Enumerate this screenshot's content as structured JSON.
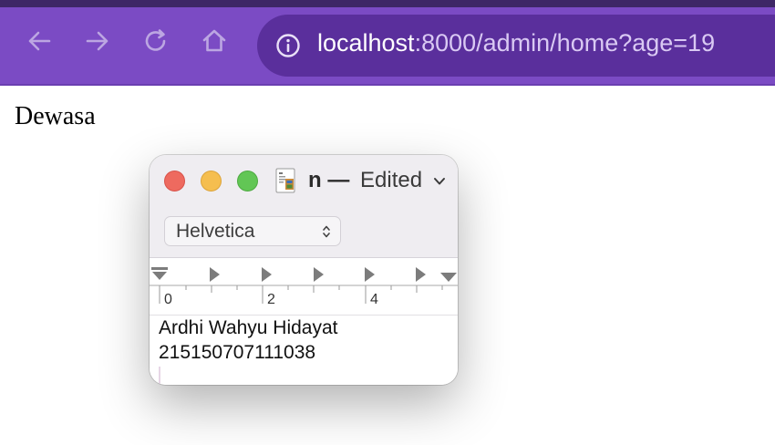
{
  "browser": {
    "url_host": "localhost",
    "url_rest": ":8000/admin/home?age=19",
    "colors": {
      "toolbar": "#7b4bc4",
      "urlbar": "#5a2f9c"
    }
  },
  "page": {
    "text": "Dewasa"
  },
  "textedit": {
    "title": "n —",
    "status": "Edited",
    "font": "Helvetica",
    "ruler_labels": [
      "0",
      "2",
      "4"
    ],
    "content": [
      "Ardhi Wahyu Hidayat",
      "215150707111038"
    ]
  }
}
